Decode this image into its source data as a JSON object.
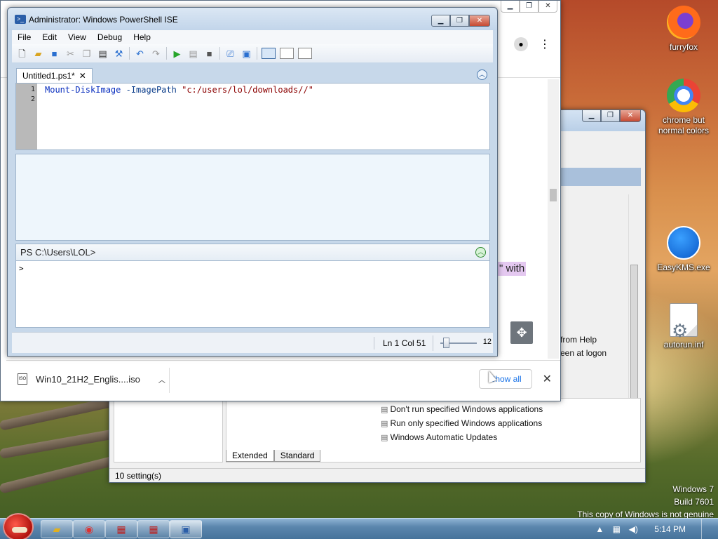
{
  "desktop": {
    "icons": [
      {
        "label": "furryfox",
        "icon": "firefox-icon"
      },
      {
        "label": "chrome but normal colors",
        "icon": "chrome-icon"
      },
      {
        "label": "EasyKMS.exe",
        "icon": "easykms-icon"
      },
      {
        "label": "autorun.inf",
        "icon": "inf-file-icon"
      }
    ],
    "watermark": {
      "line1": "Windows 7",
      "line2": "Build 7601",
      "line3": "This copy of Windows is not genuine"
    }
  },
  "browser": {
    "highlight_text": "\" with",
    "download_bar": {
      "file_name": "Win10_21H2_Englis....iso",
      "file_icon_text": "ISO",
      "show_all_label": "Show all",
      "close_glyph": "✕"
    }
  },
  "gpedit": {
    "side_text": [
      "from Help",
      "een at logon"
    ],
    "list": [
      "Don't run specified Windows applications",
      "Run only specified Windows applications",
      "Windows Automatic Updates"
    ],
    "tabs": [
      "Extended",
      "Standard"
    ],
    "status": "10 setting(s)"
  },
  "ise": {
    "title": "Administrator: Windows PowerShell ISE",
    "menu": [
      "File",
      "Edit",
      "View",
      "Debug",
      "Help"
    ],
    "tab": {
      "label": "Untitled1.ps1*",
      "close_glyph": "✕"
    },
    "editor": {
      "line_numbers": [
        "1",
        "2"
      ],
      "command": "Mount-DiskImage",
      "param": "-ImagePath",
      "string": "\"c:/users/lol/downloads//\""
    },
    "prompt": "PS C:\\Users\\LOL>",
    "console_text": ">",
    "status": {
      "position": "Ln 1  Col 51",
      "zoom": "12"
    }
  },
  "taskbar": {
    "clock": "5:14 PM"
  }
}
